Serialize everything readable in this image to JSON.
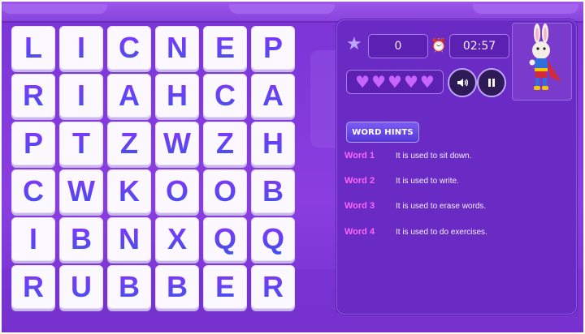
{
  "grid": {
    "rows": [
      [
        "L",
        "I",
        "C",
        "N",
        "E",
        "P"
      ],
      [
        "R",
        "I",
        "A",
        "H",
        "C",
        "A"
      ],
      [
        "P",
        "T",
        "Z",
        "W",
        "Z",
        "H"
      ],
      [
        "C",
        "W",
        "K",
        "O",
        "O",
        "B"
      ],
      [
        "I",
        "B",
        "N",
        "X",
        "Q",
        "Q"
      ],
      [
        "R",
        "U",
        "B",
        "B",
        "E",
        "R"
      ]
    ]
  },
  "hud": {
    "score_icon": "star-icon",
    "score": "0",
    "timer_icon": "alarm-clock-icon",
    "timer": "02:57",
    "lives_icon": "heart-icon",
    "lives": 5,
    "sound_icon": "speaker-icon",
    "pause_icon": "pause-icon",
    "avatar": "bunny-superhero-avatar"
  },
  "hints": {
    "button_label": "WORD HINTS",
    "items": [
      {
        "label": "Word 1",
        "text": "It is used to sit down."
      },
      {
        "label": "Word 2",
        "text": "It is used to write."
      },
      {
        "label": "Word 3",
        "text": "It is used to erase words."
      },
      {
        "label": "Word 4",
        "text": "It is used to do exercises."
      }
    ]
  },
  "colors": {
    "background": "#8a3ee0",
    "panel": "#6a2bc4",
    "tile": "#fbf9ff",
    "letter_gradient_top": "#8a33ff",
    "letter_gradient_bottom": "#3d54e8",
    "hint_label": "#ff66ff",
    "heart": "#c865ff"
  }
}
